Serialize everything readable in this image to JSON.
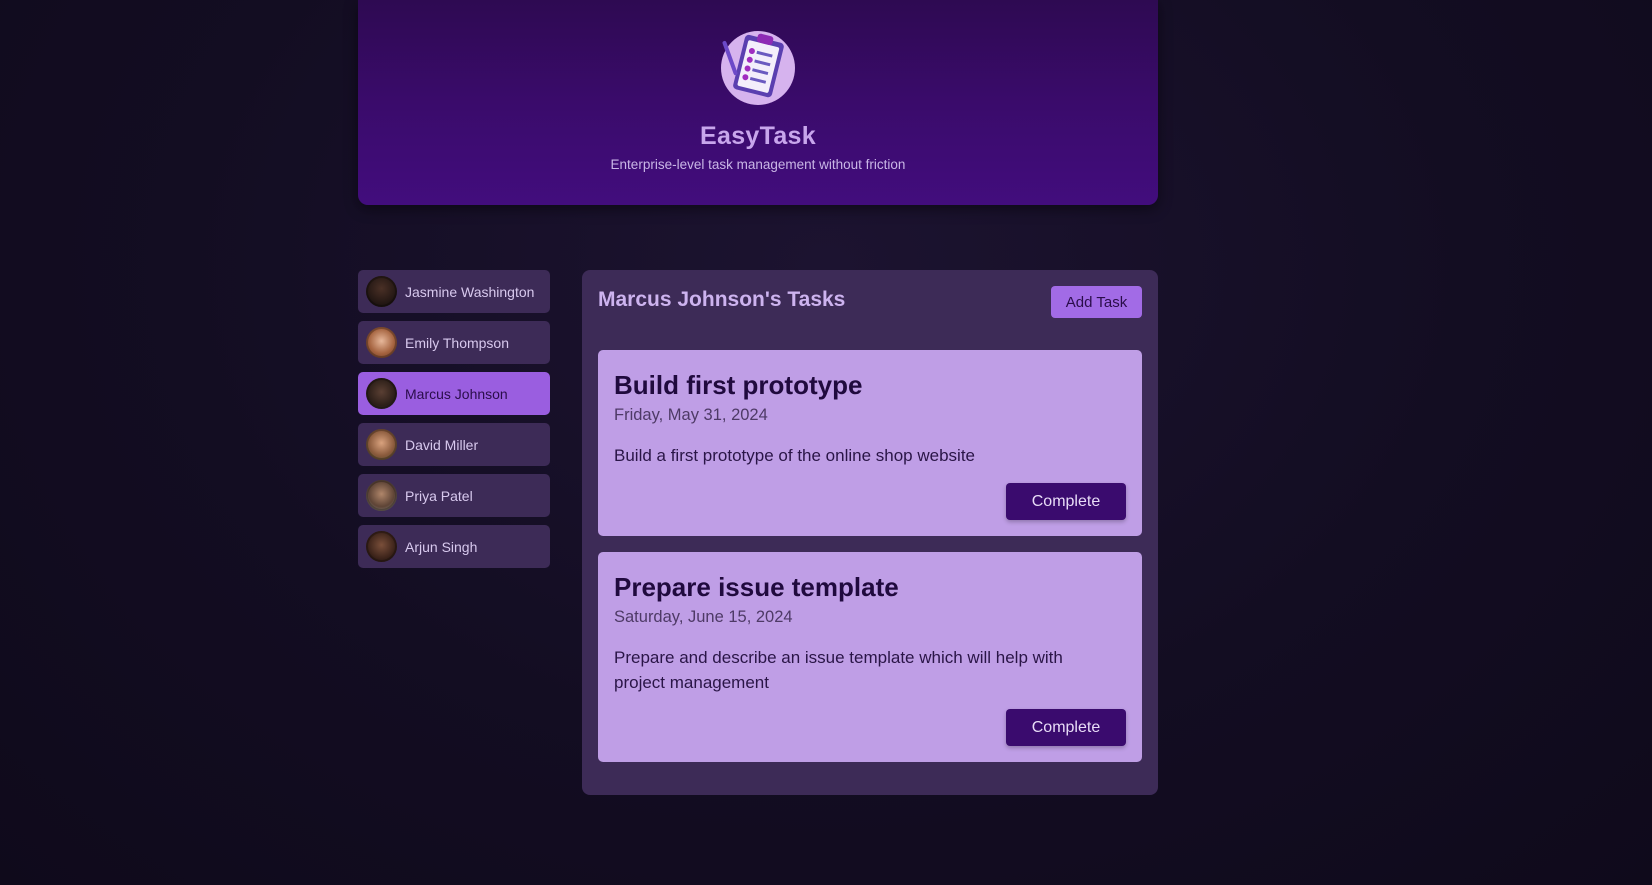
{
  "app": {
    "title": "EasyTask",
    "tagline": "Enterprise-level task management without friction",
    "logo_icon": "clipboard-checklist-icon"
  },
  "users": [
    {
      "name": "Jasmine Washington",
      "avatar_color": "#2a1d18",
      "selected": false
    },
    {
      "name": "Emily Thompson",
      "avatar_color": "#b07a5c",
      "selected": false
    },
    {
      "name": "Marcus Johnson",
      "avatar_color": "#3a2a22",
      "selected": true
    },
    {
      "name": "David Miller",
      "avatar_color": "#8a5a3c",
      "selected": false
    },
    {
      "name": "Priya Patel",
      "avatar_color": "#7a6a58",
      "selected": false
    },
    {
      "name": "Arjun Singh",
      "avatar_color": "#3d2a22",
      "selected": false
    }
  ],
  "tasks_panel": {
    "title": "Marcus Johnson's Tasks",
    "add_task_label": "Add Task",
    "tasks": [
      {
        "title": "Build first prototype",
        "date": "Friday, May 31, 2024",
        "description": "Build a first prototype of the online shop website",
        "complete_label": "Complete"
      },
      {
        "title": "Prepare issue template",
        "date": "Saturday, June 15, 2024",
        "description": "Prepare and describe an issue template which will help with project management",
        "complete_label": "Complete"
      }
    ]
  },
  "colors": {
    "background": "#130d22",
    "header": "#3a0b6b",
    "panel": "#3d2b57",
    "accent": "#9a5ee0",
    "task_card": "#bf9ee6",
    "button_dark": "#3a0b6e"
  }
}
